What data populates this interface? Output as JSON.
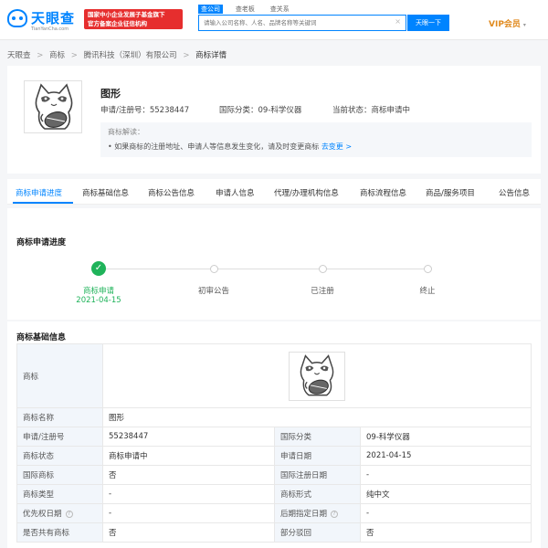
{
  "header": {
    "logo_text": "天眼查",
    "logo_sub": "TianYanCha.com",
    "gov_badge_line1": "国家中小企业发展子基金旗下",
    "gov_badge_line2": "官方备案企业征信机构",
    "search_tabs": [
      "查公司",
      "查老板",
      "查关系"
    ],
    "search_placeholder": "请输入公司名称、人名、品牌名称等关键词",
    "search_clear": "×",
    "search_button": "天眼一下",
    "vip_label": "VIP会员",
    "vip_arrow": "▾"
  },
  "breadcrumb": [
    "天眼查",
    "商标",
    "腾讯科技（深圳）有限公司",
    "商标详情"
  ],
  "breadcrumb_sep": ">",
  "trademark": {
    "title": "图形",
    "reg_no": "申请/注册号：55238447",
    "intl_class": "国际分类：09-科学仪器",
    "status": "当前状态：商标申请中",
    "interpret_title": "商标解读：",
    "interpret_body": "• 如果商标的注册地址、申请人等信息发生变化，请及时变更商标",
    "interpret_link": "去变更 >"
  },
  "tabs": [
    "商标申请进度",
    "商标基础信息",
    "商标公告信息",
    "申请人信息",
    "代理/办理机构信息",
    "商标流程信息",
    "商品/服务项目",
    "公告信息"
  ],
  "progress": {
    "title": "商标申请进度",
    "check": "✓",
    "steps": [
      {
        "label": "商标申请",
        "date": "2021-04-15"
      },
      {
        "label": "初审公告"
      },
      {
        "label": "已注册"
      },
      {
        "label": "终止"
      }
    ]
  },
  "basic": {
    "title": "商标基础信息",
    "logo_label": "商标",
    "help": "?",
    "rows": [
      {
        "l1": "商标名称",
        "v1": "图形",
        "l2": "",
        "v2": ""
      },
      {
        "l1": "申请/注册号",
        "v1": "55238447",
        "l2": "国际分类",
        "v2": "09-科学仪器"
      },
      {
        "l1": "商标状态",
        "v1": "商标申请中",
        "l2": "申请日期",
        "v2": "2021-04-15"
      },
      {
        "l1": "国际商标",
        "v1": "否",
        "l2": "国际注册日期",
        "v2": "-"
      },
      {
        "l1": "商标类型",
        "v1": "-",
        "l2": "商标形式",
        "v2": "纯中文"
      },
      {
        "l1": "优先权日期",
        "v1": "-",
        "l2": "后期指定日期",
        "v2": "-"
      },
      {
        "l1": "是否共有商标",
        "v1": "否",
        "l2": "部分驳回",
        "v2": "否"
      }
    ]
  },
  "colors": {
    "brand": "#0084ff",
    "success": "#1fb35a",
    "vip": "#e08a1e",
    "badge": "#e62e2e"
  }
}
